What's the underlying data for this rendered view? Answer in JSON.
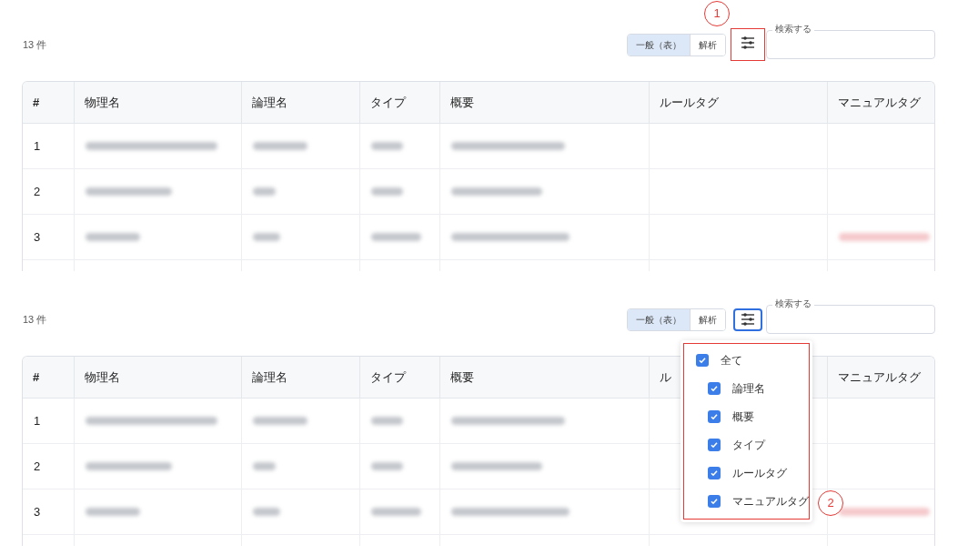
{
  "panels": [
    {
      "count": "13 件",
      "view_toggle": [
        {
          "label": "一般（表）",
          "selected": true
        },
        {
          "label": "解析",
          "selected": false
        }
      ],
      "filter_button": {
        "focused": false,
        "highlighted": true
      },
      "annotation": "1",
      "search": {
        "label": "検索する"
      },
      "table": {
        "columns": [
          "#",
          "物理名",
          "論理名",
          "タイプ",
          "概要",
          "ルールタグ",
          "マニュアルタグ"
        ],
        "rows": [
          {
            "index": "1"
          },
          {
            "index": "2"
          },
          {
            "index": "3"
          }
        ]
      }
    },
    {
      "count": "13 件",
      "view_toggle": [
        {
          "label": "一般（表）",
          "selected": true
        },
        {
          "label": "解析",
          "selected": false
        }
      ],
      "filter_button": {
        "focused": true,
        "highlighted": false
      },
      "search": {
        "label": "検索する"
      },
      "table": {
        "columns": [
          "#",
          "物理名",
          "論理名",
          "タイプ",
          "概要",
          "ル",
          "マニュアルタグ"
        ],
        "rows": [
          {
            "index": "1"
          },
          {
            "index": "2"
          },
          {
            "index": "3"
          }
        ]
      },
      "column_menu": {
        "annotation": "2",
        "items": [
          {
            "label": "全て",
            "checked": true,
            "children": [
              {
                "label": "論理名",
                "checked": true
              },
              {
                "label": "概要",
                "checked": true
              },
              {
                "label": "タイプ",
                "checked": true
              },
              {
                "label": "ルールタグ",
                "checked": true
              },
              {
                "label": "マニュアルタグ",
                "checked": true
              }
            ]
          }
        ]
      }
    }
  ]
}
